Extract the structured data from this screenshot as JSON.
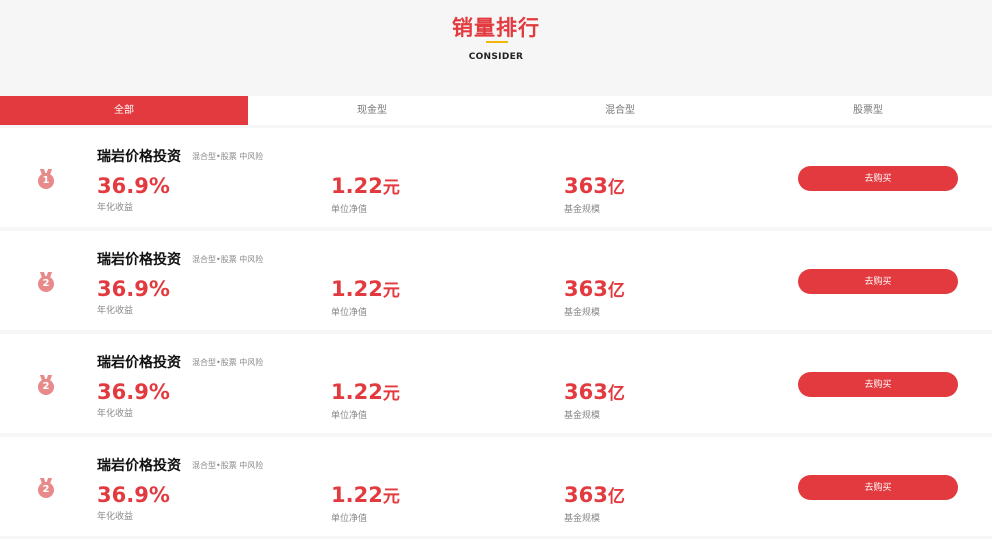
{
  "header": {
    "title": "销量排行",
    "subtitle": "CONSIDER"
  },
  "tabs": [
    {
      "label": "全部",
      "active": true
    },
    {
      "label": "现金型",
      "active": false
    },
    {
      "label": "混合型",
      "active": false
    },
    {
      "label": "股票型",
      "active": false
    }
  ],
  "funds": [
    {
      "rank": "1",
      "name": "瑞岩价格投资",
      "tags": "混合型•股票 中风险",
      "annual_return": "36.9%",
      "annual_return_label": "年化收益",
      "nav": "1.22",
      "nav_unit": "元",
      "nav_label": "单位净值",
      "size": "363",
      "size_unit": "亿",
      "size_label": "基金规模",
      "buy_label": "去购买"
    },
    {
      "rank": "2",
      "name": "瑞岩价格投资",
      "tags": "混合型•股票 中风险",
      "annual_return": "36.9%",
      "annual_return_label": "年化收益",
      "nav": "1.22",
      "nav_unit": "元",
      "nav_label": "单位净值",
      "size": "363",
      "size_unit": "亿",
      "size_label": "基金规模",
      "buy_label": "去购买"
    },
    {
      "rank": "2",
      "name": "瑞岩价格投资",
      "tags": "混合型•股票 中风险",
      "annual_return": "36.9%",
      "annual_return_label": "年化收益",
      "nav": "1.22",
      "nav_unit": "元",
      "nav_label": "单位净值",
      "size": "363",
      "size_unit": "亿",
      "size_label": "基金规模",
      "buy_label": "去购买"
    },
    {
      "rank": "2",
      "name": "瑞岩价格投资",
      "tags": "混合型•股票 中风险",
      "annual_return": "36.9%",
      "annual_return_label": "年化收益",
      "nav": "1.22",
      "nav_unit": "元",
      "nav_label": "单位净值",
      "size": "363",
      "size_unit": "亿",
      "size_label": "基金规模",
      "buy_label": "去购买"
    }
  ],
  "colors": {
    "accent": "#e23a3f",
    "underline": "#f2b705",
    "medal": "#e8898a"
  },
  "icons": {
    "rank": "medal-icon"
  }
}
